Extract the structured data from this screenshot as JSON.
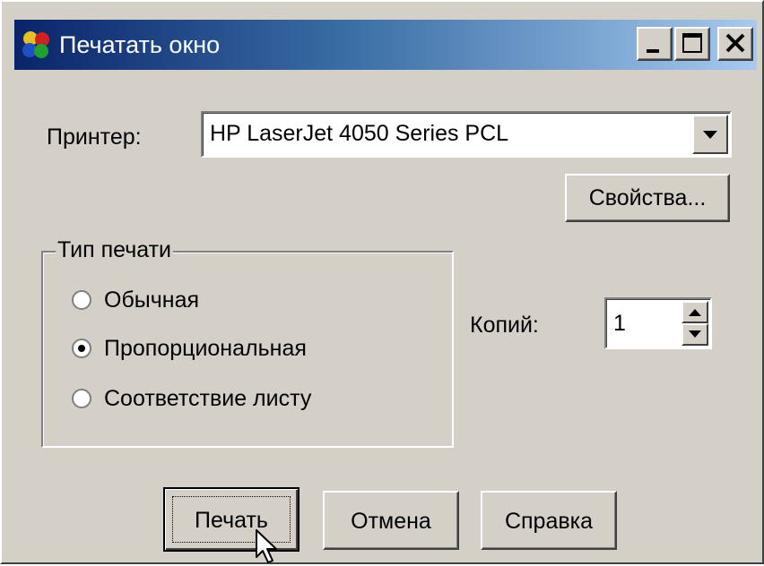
{
  "window": {
    "title": "Печатать окно",
    "icon": "colored-balls-icon"
  },
  "printer": {
    "label": "Принтер:",
    "selected": "HP LaserJet 4050 Series PCL",
    "properties_button": "Свойства..."
  },
  "print_type": {
    "legend": "Тип печати",
    "options": [
      {
        "label": "Обычная",
        "checked": false
      },
      {
        "label": "Пропорциональная",
        "checked": true
      },
      {
        "label": "Соответствие листу",
        "checked": false
      }
    ]
  },
  "copies": {
    "label": "Копий:",
    "value": "1"
  },
  "buttons": {
    "print": "Печать",
    "cancel": "Отмена",
    "help": "Справка"
  }
}
